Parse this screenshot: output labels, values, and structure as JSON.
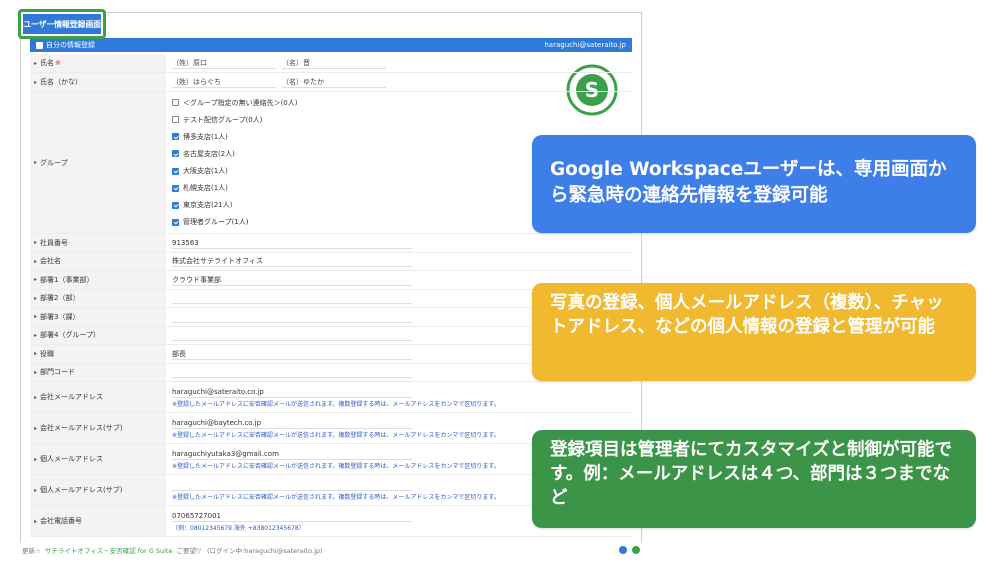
{
  "page_title": "ユーザー情報登録画面",
  "section": {
    "title": "自分の情報登録",
    "user_email": "haraguchi@sateraito.jp"
  },
  "fields": {
    "name": {
      "label": "氏名",
      "required_mark": "※",
      "last_prefix": "（姓）",
      "last": "原口",
      "first_prefix": "（名）",
      "first": "晋"
    },
    "kana": {
      "label": "氏名（かな）",
      "last_prefix": "（姓）",
      "last": "はらぐち",
      "first_prefix": "（名）",
      "first": "ゆたか"
    },
    "groups": {
      "label": "グループ",
      "items": [
        {
          "label": "＜グループ指定の無い連絡先＞(0人)",
          "checked": false
        },
        {
          "label": "テスト配信グループ(0人)",
          "checked": false
        },
        {
          "label": "博多支店(1人)",
          "checked": true
        },
        {
          "label": "名古屋支店(2人)",
          "checked": true
        },
        {
          "label": "大阪支店(1人)",
          "checked": true
        },
        {
          "label": "札幌支店(1人)",
          "checked": true
        },
        {
          "label": "東京支店(21人)",
          "checked": true
        },
        {
          "label": "管理者グループ(1人)",
          "checked": true
        }
      ]
    },
    "employee_no": {
      "label": "社員番号",
      "value": "913563"
    },
    "company": {
      "label": "会社名",
      "value": "株式会社サテライトオフィス"
    },
    "dept1": {
      "label": "部署1（事業部）",
      "value": "クラウド事業部"
    },
    "dept2": {
      "label": "部署2（部）",
      "value": ""
    },
    "dept3": {
      "label": "部署3（課）",
      "value": ""
    },
    "dept4": {
      "label": "部署4（グループ）",
      "value": ""
    },
    "position": {
      "label": "役職",
      "value": "部長"
    },
    "dept_code": {
      "label": "部門コード",
      "value": ""
    },
    "company_email": {
      "label": "会社メールアドレス",
      "value": "haraguchi@sateraito.co.jp",
      "note": "※登録したメールアドレスに安否確認メールが送信されます。複数登録する時は、メールアドレスをカンマで区切ります。"
    },
    "company_email_sub": {
      "label": "会社メールアドレス(サブ)",
      "value": "haraguchi@baytech.co.jp",
      "note": "※登録したメールアドレスに安否確認メールが送信されます。複数登録する時は、メールアドレスをカンマで区切ります。"
    },
    "personal_email": {
      "label": "個人メールアドレス",
      "value": "haraguchiyutaka3@gmail.com",
      "note": "※登録したメールアドレスに安否確認メールが送信されます。複数登録する時は、メールアドレスをカンマで区切ります。"
    },
    "personal_email_sub": {
      "label": "個人メールアドレス(サブ)",
      "value": "",
      "note": "※登録したメールアドレスに安否確認メールが送信されます。複数登録する時は、メールアドレスをカンマで区切ります。"
    },
    "company_phone": {
      "label": "会社電話番号",
      "value": "07065727001",
      "note": "（例：08012345679 海外 +838012345678）"
    }
  },
  "footer": {
    "prefix": "更新☆",
    "brand": "サテライトオフィス・安否確認 for G Suite",
    "links": "ご要望▽",
    "login": "(ログイン中:haraguchi@sateraito.jp)"
  },
  "callouts": {
    "blue": "Google Workspaceユーザーは、専用画面から緊急時の連絡先情報を登録可能",
    "yellow": "写真の登録、個人メールアドレス（複数）、チャットアドレス、などの個人情報の登録と管理が可能",
    "green": "登録項目は管理者にてカスタマイズと制御が可能です。例：メールアドレスは４つ、部門は３つまでなど"
  },
  "colors": {
    "header_blue": "#2f7ad6",
    "accent_green": "#3aa04a",
    "note_blue": "#2a58c9",
    "callout_blue": "#3e7ee8",
    "callout_yellow": "#f0b930",
    "callout_green": "#3b9447"
  }
}
